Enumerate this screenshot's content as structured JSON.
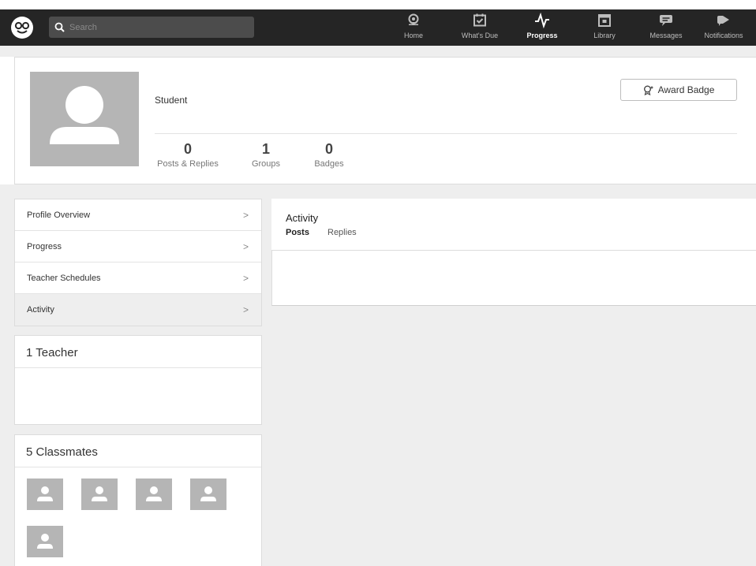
{
  "search": {
    "placeholder": "Search"
  },
  "nav": [
    {
      "label": "Home",
      "icon": "home-icon"
    },
    {
      "label": "What's Due",
      "icon": "calendar-check-icon"
    },
    {
      "label": "Progress",
      "icon": "pulse-icon",
      "active": true
    },
    {
      "label": "Library",
      "icon": "library-icon"
    },
    {
      "label": "Messages",
      "icon": "message-icon"
    },
    {
      "label": "Notifications",
      "icon": "megaphone-icon"
    }
  ],
  "profile": {
    "role": "Student",
    "award_label": "Award Badge",
    "stats": [
      {
        "value": "0",
        "label": "Posts & Replies"
      },
      {
        "value": "1",
        "label": "Groups"
      },
      {
        "value": "0",
        "label": "Badges"
      }
    ]
  },
  "menu": [
    {
      "label": "Profile Overview",
      "chevron": ">"
    },
    {
      "label": "Progress",
      "chevron": ">"
    },
    {
      "label": "Teacher Schedules",
      "chevron": ">"
    },
    {
      "label": "Activity",
      "chevron": ">",
      "selected": true
    }
  ],
  "teachers": {
    "title": "1 Teacher"
  },
  "classmates": {
    "title": "5 Classmates",
    "count": 5
  },
  "activity": {
    "title": "Activity",
    "tabs": [
      "Posts",
      "Replies"
    ]
  },
  "colors": {
    "topbar": "#252525",
    "page_bg": "#eeeeee",
    "avatar": "#b5b5b5"
  }
}
